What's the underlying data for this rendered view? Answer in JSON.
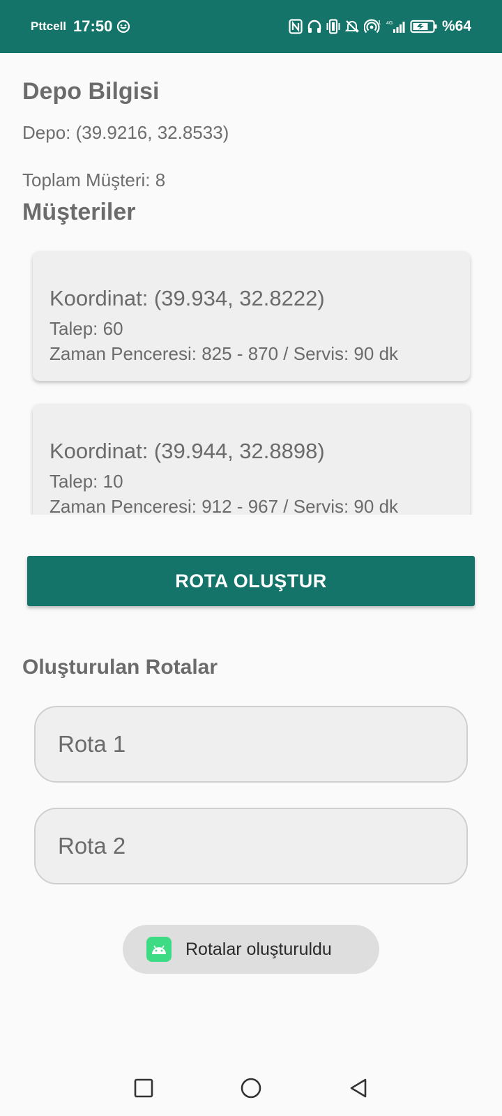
{
  "status_bar": {
    "carrier": "Pttcell",
    "time": "17:50",
    "battery": "%64",
    "icons": [
      "smiley-icon",
      "nfc-icon",
      "headphones-icon",
      "vibrate-icon",
      "mute-icon",
      "hotspot-icon",
      "signal-icon",
      "battery-charging-icon"
    ]
  },
  "depot": {
    "heading": "Depo Bilgisi",
    "location": "Depo: (39.9216, 32.8533)",
    "total_customers": "Toplam Müşteri: 8"
  },
  "customers": {
    "heading": "Müşteriler",
    "items": [
      {
        "coord": "Koordinat: (39.934, 32.8222)",
        "demand": "Talep: 60",
        "window": "Zaman Penceresi: 825 - 870 / Servis: 90 dk"
      },
      {
        "coord": "Koordinat: (39.944, 32.8898)",
        "demand": "Talep: 10",
        "window": "Zaman Penceresi: 912 - 967 / Servis: 90 dk"
      }
    ]
  },
  "action": {
    "create_route_label": "ROTA OLUŞTUR"
  },
  "routes": {
    "heading": "Oluşturulan Rotalar",
    "items": [
      {
        "label": "Rota 1"
      },
      {
        "label": "Rota 2"
      }
    ]
  },
  "toast": {
    "message": "Rotalar oluşturuldu",
    "icon": "android-icon"
  },
  "nav": {
    "icons": [
      "recents-icon",
      "home-icon",
      "back-icon"
    ]
  },
  "colors": {
    "primary": "#15746a",
    "card_bg": "#efefef",
    "text": "#6b6b6b",
    "toast_bg": "#dedede"
  }
}
